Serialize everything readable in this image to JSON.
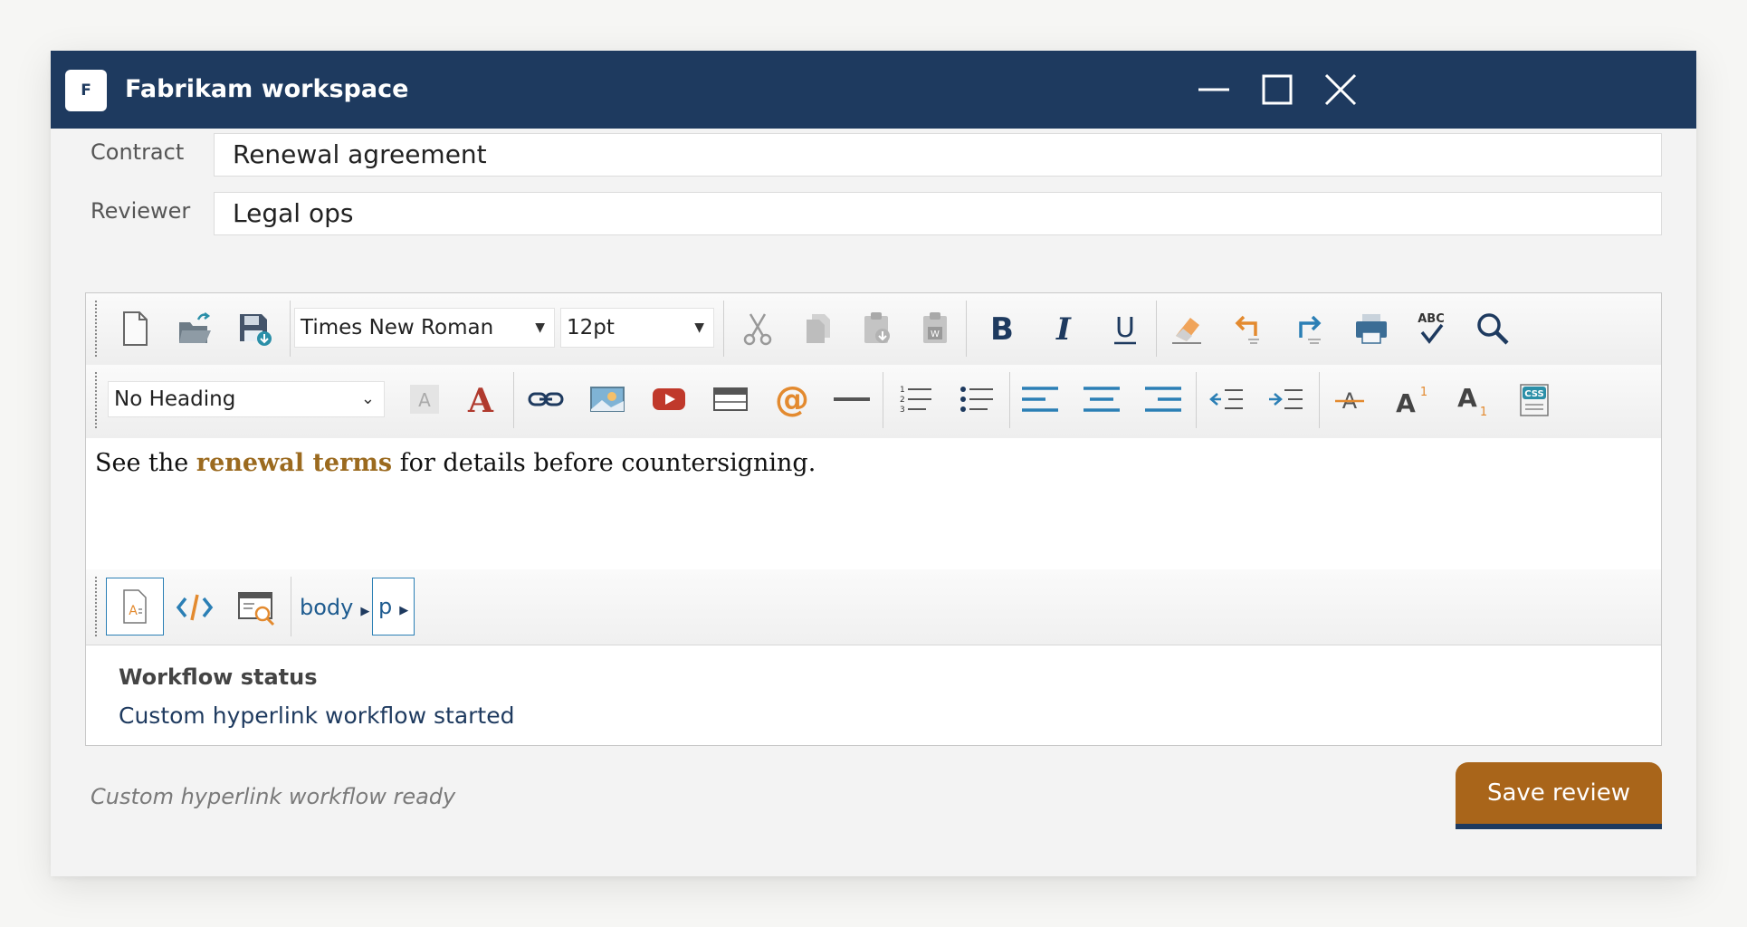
{
  "window": {
    "title": "Fabrikam workspace",
    "icon_letter": "F"
  },
  "fields": [
    {
      "label": "Contract",
      "value": "Renewal agreement"
    },
    {
      "label": "Reviewer",
      "value": "Legal ops"
    }
  ],
  "toolbar": {
    "font_family": "Times New Roman",
    "font_size": "12pt",
    "heading": "No Heading"
  },
  "content": {
    "before": "See the ",
    "link": "renewal terms",
    "after": " for details before countersigning."
  },
  "path": [
    "body",
    "p"
  ],
  "status": {
    "title": "Workflow status",
    "text": "Custom hyperlink workflow started"
  },
  "footer": {
    "text": "Custom hyperlink workflow ready",
    "save_label": "Save review"
  },
  "colors": {
    "titlebar": "#1e3a5f",
    "accent": "#a9651a",
    "link": "#9b6a1f"
  }
}
